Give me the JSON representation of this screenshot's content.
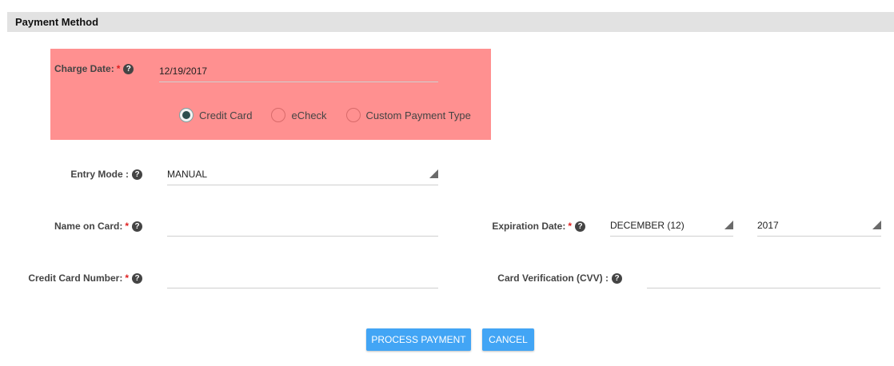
{
  "section": {
    "title": "Payment Method"
  },
  "charge_date": {
    "label": "Charge Date:",
    "required": "*",
    "value": "12/19/2017"
  },
  "payment_types": [
    {
      "label": "Credit Card",
      "checked": true
    },
    {
      "label": "eCheck",
      "checked": false
    },
    {
      "label": "Custom Payment Type",
      "checked": false
    }
  ],
  "entry_mode": {
    "label": "Entry Mode :",
    "value": "MANUAL"
  },
  "name_on_card": {
    "label": "Name on Card:",
    "required": "*",
    "value": ""
  },
  "expiration": {
    "label": "Expiration Date:",
    "required": "*",
    "month": "DECEMBER (12)",
    "year": "2017"
  },
  "card_number": {
    "label": "Credit Card Number:",
    "required": "*",
    "value": ""
  },
  "cvv": {
    "label": "Card Verification (CVV) :",
    "value": ""
  },
  "buttons": {
    "process": "PROCESS PAYMENT",
    "cancel": "CANCEL"
  },
  "icons": {
    "help": "question-circle-icon",
    "dropdown": "dropdown-triangle-icon"
  },
  "colors": {
    "highlight": "#ff9090",
    "button": "#42a5f5",
    "required": "#e02020"
  }
}
